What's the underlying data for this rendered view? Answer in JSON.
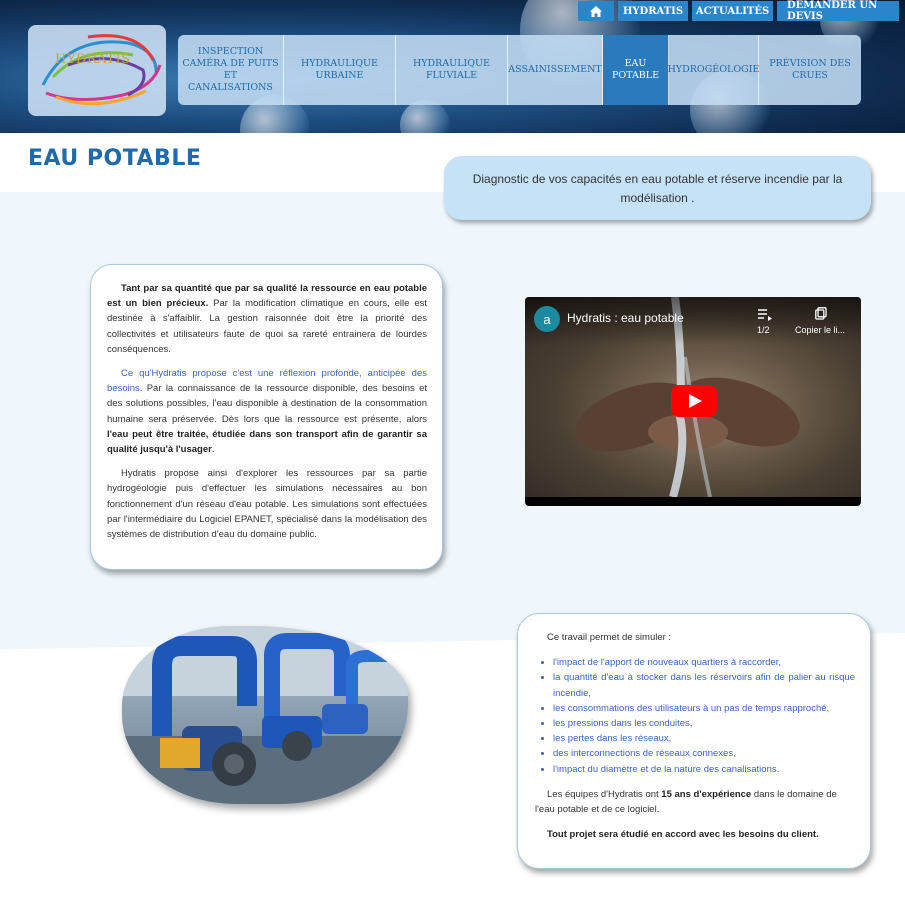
{
  "header": {
    "logo_text": "HYDRATIS",
    "top_nav": [
      "HYDRATIS",
      "ACTUALITÉS",
      "DEMANDER UN DEVIS"
    ],
    "main_nav": [
      {
        "label": "INSPECTION CAMÉRA DE PUITS ET CANALISATIONS",
        "active": false
      },
      {
        "label": "HYDRAULIQUE URBAINE",
        "active": false
      },
      {
        "label": "HYDRAULIQUE FLUVIALE",
        "active": false
      },
      {
        "label": "ASSAINISSEMENT",
        "active": false
      },
      {
        "label": "EAU POTABLE",
        "active": true
      },
      {
        "label": "HYDROGÉOLOGIE",
        "active": false
      },
      {
        "label": "PRÉVISION DES CRUES",
        "active": false
      }
    ]
  },
  "page": {
    "title": "EAU POTABLE",
    "diagnostic": "Diagnostic de vos capacités en eau potable et réserve incendie par la modélisation ."
  },
  "intro_card": {
    "p1_bold": "Tant par sa quantité que par sa qualité la ressource en eau potable est un bien précieux.",
    "p1_rest": " Par la modification climatique en cours, elle est destinée à s'affaiblir. La gestion raisonnée doit être la priorité des collectivités et utilisateurs faute de quoi sa rareté entrainera de lourdes conséquences.",
    "p2_blue": "Ce qu'Hydratis propose c'est une réflexion profonde, anticipée des besoins",
    "p2_mid": ". Par la connaissance de la ressource disponible, des besoins et des solutions possibles, l'eau disponible à destination de la consommation humaine sera préservée. Dès lors que la ressource est présente, alors ",
    "p2_bold": "l'eau peut être traitée, étudiée dans son transport afin de garantir sa qualité jusqu'à l'usager",
    "p2_end": ".",
    "p3": "Hydratis propose ainsi d'explorer les ressources par sa partie hydrogéologie puis d'effectuer les simulations nécessaires au bon fonctionnement d'un réseau d'eau potable. Les simulations sont effectuées par l'intermédiaire du Logiciel EPANET, spécialisé dans la modélisation des systèmes de distribution d'eau du domaine public."
  },
  "video": {
    "avatar_letter": "a",
    "title": "Hydratis : eau potable",
    "count": "1/2",
    "copy_label": "Copier le li..."
  },
  "simulate_card": {
    "intro": "Ce travail permet de simuler :",
    "items": [
      "l'impact de l'apport de nouveaux quartiers à raccorder,",
      "la quantité d'eau à stocker dans les réservoirs afin de palier au risque incendie,",
      "les consommations des utilisateurs à un pas de temps rapproché,",
      "les pressions dans les conduites,",
      "les pertes dans les réseaux,",
      "des interconnections de réseaux connexes,",
      "l'impact du diamètre et de la nature des canalisations."
    ],
    "exp_pre": "Les équipes d'Hydratis ont ",
    "exp_bold": "15 ans d'expérience",
    "exp_post": " dans le domaine de l'eau potable et de ce logiciel.",
    "final": "Tout projet sera étudié en accord avec les besoins du client."
  },
  "colors": {
    "accent": "#1f6aa8",
    "nav_active": "#2a7bbd",
    "link_blue": "#3b62c4",
    "band_bg": "#eff7fc",
    "diagnostic_bg": "#c5e2f6"
  }
}
